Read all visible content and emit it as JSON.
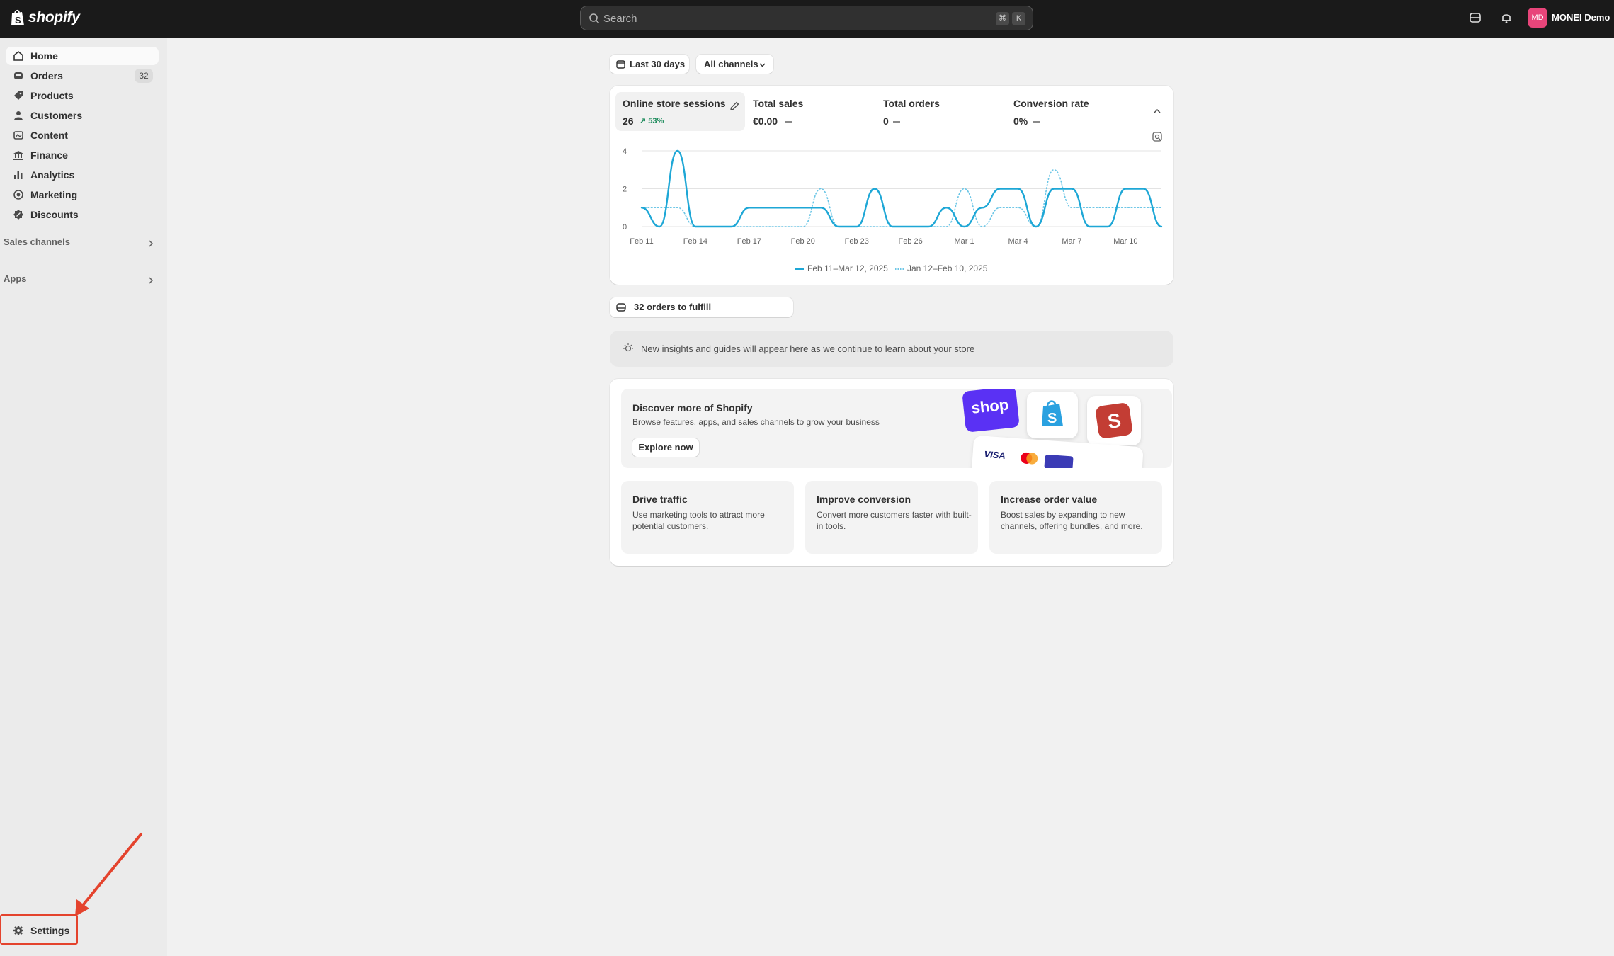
{
  "topbar": {
    "brand": "shopify",
    "search_placeholder": "Search",
    "shortcut_keys": [
      "⌘",
      "K"
    ],
    "avatar_initials": "MD",
    "avatar_color": "#e8457a",
    "store_name": "MONEI Demo"
  },
  "sidebar": {
    "items": [
      {
        "label": "Home",
        "icon": "home-icon",
        "active": true
      },
      {
        "label": "Orders",
        "icon": "orders-icon",
        "badge": "32"
      },
      {
        "label": "Products",
        "icon": "tag-icon"
      },
      {
        "label": "Customers",
        "icon": "person-icon"
      },
      {
        "label": "Content",
        "icon": "content-icon"
      },
      {
        "label": "Finance",
        "icon": "bank-icon"
      },
      {
        "label": "Analytics",
        "icon": "bar-chart-icon"
      },
      {
        "label": "Marketing",
        "icon": "target-icon"
      },
      {
        "label": "Discounts",
        "icon": "discount-icon"
      }
    ],
    "sections": [
      "Sales channels",
      "Apps"
    ],
    "settings_label": "Settings",
    "highlight_color": "#e4432d"
  },
  "filters": {
    "date_range": "Last 30 days",
    "channels": "All channels"
  },
  "metrics": [
    {
      "title": "Online store sessions",
      "value": "26",
      "delta": "53%"
    },
    {
      "title": "Total sales",
      "value": "€0.00"
    },
    {
      "title": "Total orders",
      "value": "0"
    },
    {
      "title": "Conversion rate",
      "value": "0%"
    }
  ],
  "chart_data": {
    "type": "line",
    "x": [
      "Feb 11",
      "Feb 12",
      "Feb 13",
      "Feb 14",
      "Feb 15",
      "Feb 16",
      "Feb 17",
      "Feb 18",
      "Feb 19",
      "Feb 20",
      "Feb 21",
      "Feb 22",
      "Feb 23",
      "Feb 24",
      "Feb 25",
      "Feb 26",
      "Feb 27",
      "Feb 28",
      "Mar 1",
      "Mar 2",
      "Mar 3",
      "Mar 4",
      "Mar 5",
      "Mar 6",
      "Mar 7",
      "Mar 8",
      "Mar 9",
      "Mar 10",
      "Mar 11",
      "Mar 12"
    ],
    "tick_labels": [
      "Feb 11",
      "Feb 14",
      "Feb 17",
      "Feb 20",
      "Feb 23",
      "Feb 26",
      "Mar 1",
      "Mar 4",
      "Mar 7",
      "Mar 10"
    ],
    "yticks": [
      "4",
      "2",
      "0"
    ],
    "ylim": [
      0,
      4
    ],
    "series": [
      {
        "name": "Feb 11–Mar 12, 2025",
        "style": "solid",
        "color": "#1ea7d6",
        "values": [
          1,
          0,
          4,
          0,
          0,
          0,
          1,
          1,
          1,
          1,
          1,
          0,
          0,
          2,
          0,
          0,
          0,
          1,
          0,
          1,
          2,
          2,
          0,
          2,
          2,
          0,
          0,
          2,
          2,
          0
        ]
      },
      {
        "name": "Jan 12–Feb 10, 2025",
        "style": "dotted",
        "color": "#6cc6e6",
        "values": [
          1,
          1,
          1,
          0,
          0,
          0,
          0,
          0,
          0,
          0,
          2,
          0,
          0,
          0,
          0,
          0,
          0,
          0,
          2,
          0,
          1,
          1,
          0,
          3,
          1,
          1,
          1,
          1,
          1,
          1
        ]
      }
    ],
    "grid": true
  },
  "fulfill": {
    "label": "32 orders to fulfill"
  },
  "insights": {
    "text": "New insights and guides will appear here as we continue to learn about your store"
  },
  "discover": {
    "title": "Discover more of Shopify",
    "subtitle": "Browse features, apps, and sales channels to grow your business",
    "button": "Explore now",
    "shop_logo_text": "shop",
    "payment_card_text": "VISA"
  },
  "tiles": [
    {
      "title": "Drive traffic",
      "body": "Use marketing tools to attract more potential customers."
    },
    {
      "title": "Improve conversion",
      "body": "Convert more customers faster with built-in tools."
    },
    {
      "title": "Increase order value",
      "body": "Boost sales by expanding to new channels, offering bundles, and more."
    }
  ]
}
